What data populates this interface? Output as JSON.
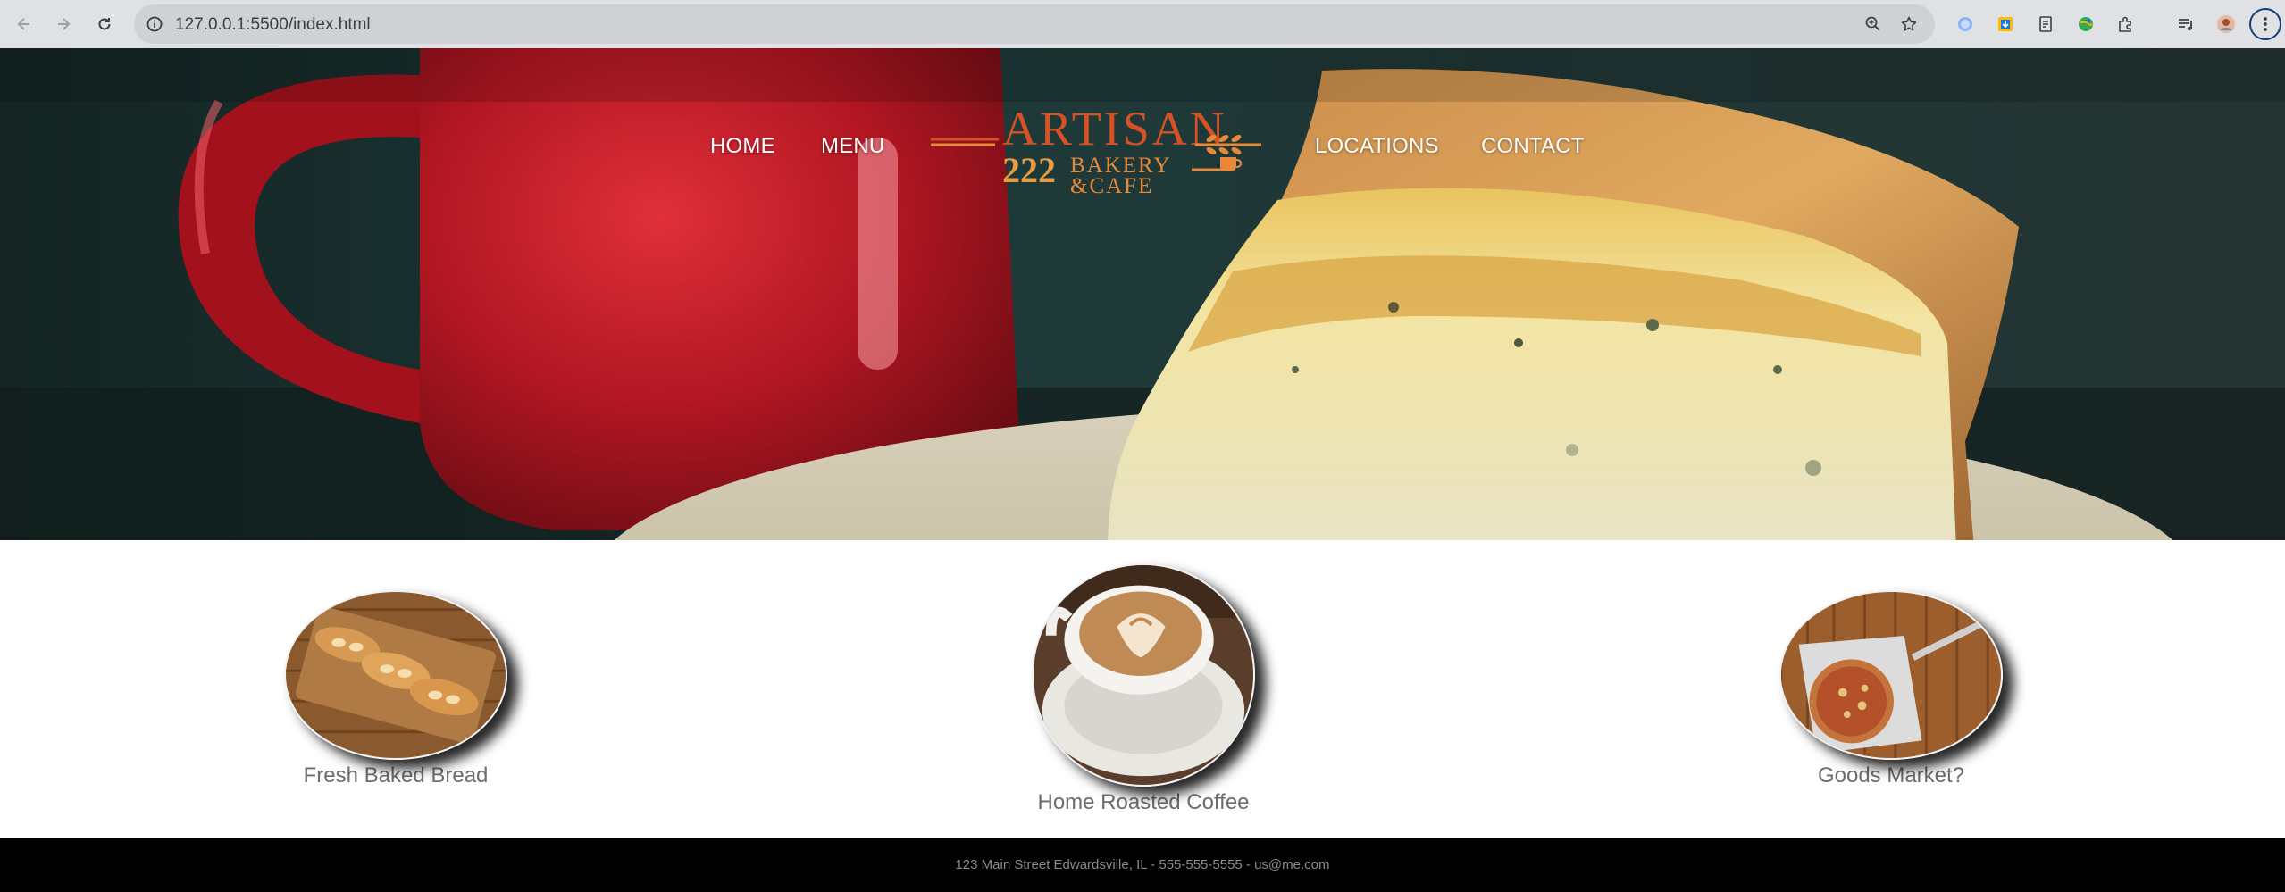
{
  "browser": {
    "url": "127.0.0.1:5500/index.html",
    "buttons": {
      "back": "back-icon",
      "forward": "forward-icon",
      "reload": "reload-icon"
    },
    "omnibox_icons": [
      "site-info-icon",
      "zoom-icon",
      "bookmark-star-icon"
    ],
    "extensions": [
      "profile-circle-icon",
      "download-extension-icon",
      "document-extension-icon",
      "globe-extension-icon",
      "puzzle-extensions-icon",
      "media-queue-icon",
      "avatar-icon",
      "kebab-menu-icon"
    ]
  },
  "nav": {
    "home": "HOME",
    "menu": "MENU",
    "locations": "LOCATIONS",
    "contact": "CONTACT"
  },
  "logo": {
    "artisan": "ARTISAN",
    "number": "222",
    "bakery": "BAKERY",
    "cafe": "&CAFE"
  },
  "features": [
    {
      "caption": "Fresh Baked Bread",
      "image": "bread-loaves-on-board"
    },
    {
      "caption": "Home Roasted Coffee",
      "image": "latte-cup-on-saucer"
    },
    {
      "caption": "Goods Market?",
      "image": "pizza-on-peel"
    }
  ],
  "footer": {
    "text": "123 Main Street Edwardsville, IL - 555-555-5555 - us@me.com"
  },
  "colors": {
    "chrome": "#dfe1e5",
    "logo_red": "#d45224",
    "logo_orange": "#e8893a",
    "footer_bg": "#000000",
    "caption_gray": "#6d6d6d"
  }
}
